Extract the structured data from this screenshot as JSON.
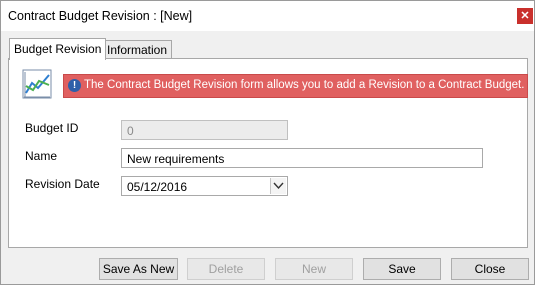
{
  "window": {
    "title": "Contract Budget Revision : [New]"
  },
  "tabs": [
    {
      "label": "Budget Revision",
      "active": true
    },
    {
      "label": "Information",
      "active": false
    }
  ],
  "banner": {
    "message": "The Contract Budget Revision form allows you to add a Revision to a Contract Budget."
  },
  "form": {
    "budget_id": {
      "label": "Budget ID",
      "value": "0"
    },
    "name": {
      "label": "Name",
      "value": "New requirements"
    },
    "revision_date": {
      "label": "Revision Date",
      "value": "05/12/2016"
    }
  },
  "buttons": {
    "save_as_new": "Save As New",
    "delete": "Delete",
    "new": "New",
    "save": "Save",
    "close": "Close"
  },
  "colors": {
    "banner_bg": "#e06060",
    "close_bg": "#c9302c"
  }
}
